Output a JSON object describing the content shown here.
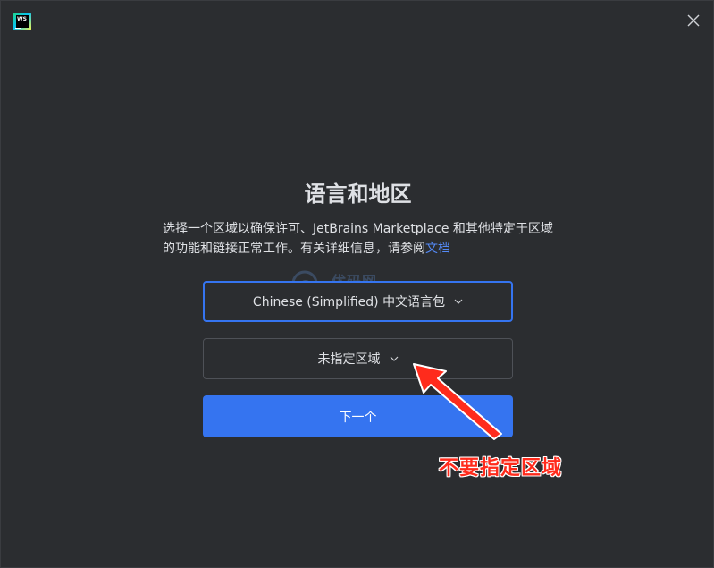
{
  "window": {
    "logo_text": "WS"
  },
  "main": {
    "title": "语言和地区",
    "description_text": "选择一个区域以确保许可、JetBrains Marketplace 和其他特定于区域的功能和链接正常工作。有关详细信息，请参阅",
    "docs_link": "文档",
    "language_select": {
      "value": "Chinese (Simplified) 中文语言包"
    },
    "region_select": {
      "value": "未指定区域"
    },
    "next_button": "下一个"
  },
  "overlay": {
    "watermark_text": "优码网",
    "annotation_text": "不要指定区域",
    "annotation_color": "#ff2b1c"
  },
  "colors": {
    "background": "#2b2d30",
    "accent": "#3574f0",
    "link": "#548af7"
  }
}
